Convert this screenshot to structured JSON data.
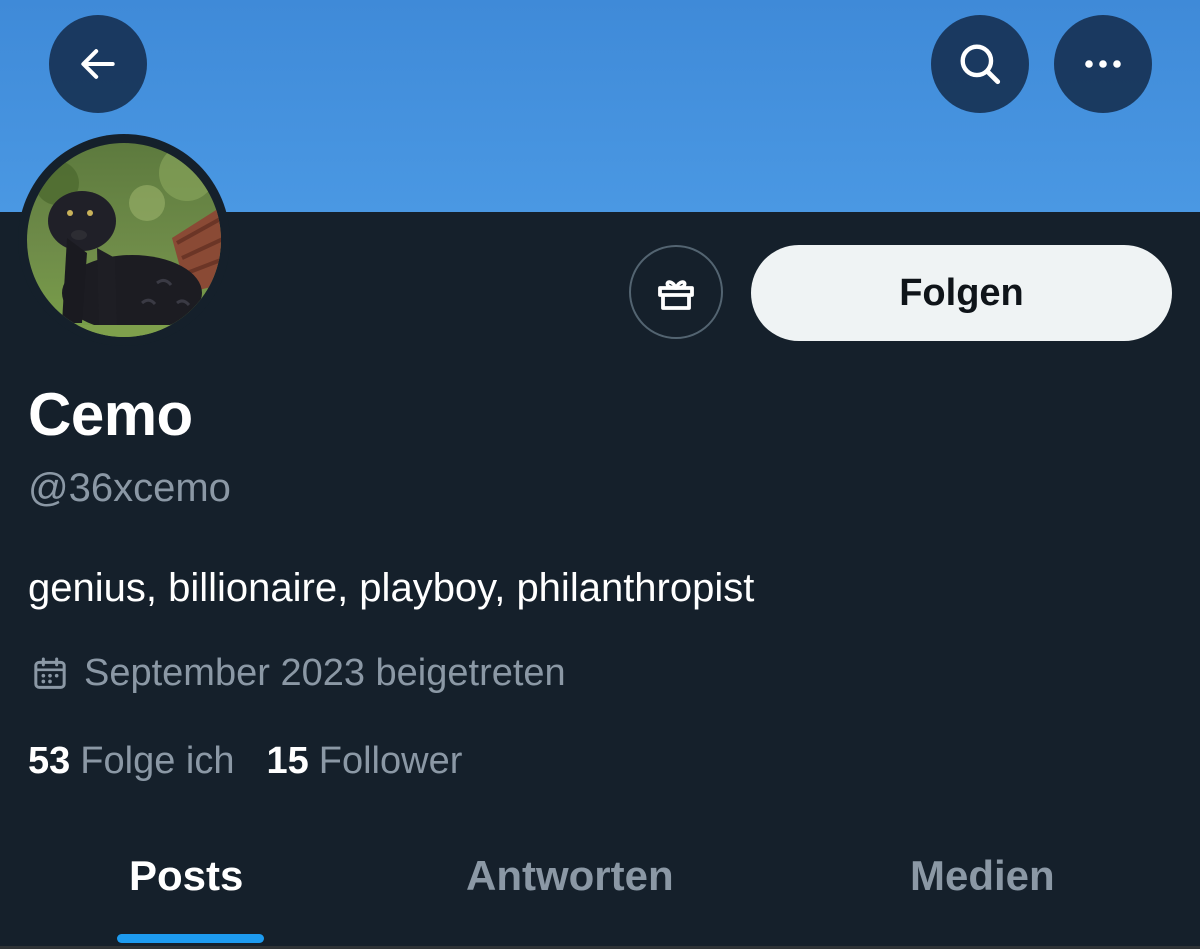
{
  "header": {
    "back_icon": "arrow-left-icon",
    "search_icon": "search-icon",
    "more_icon": "more-horizontal-icon",
    "banner_color": "#4a98e3"
  },
  "profile": {
    "display_name": "Cemo",
    "handle": "@36xcemo",
    "bio": "genius, billionaire, playboy, philanthropist",
    "joined": "September 2023 beigetreten",
    "following_count": "53",
    "following_label": "Folge ich",
    "followers_count": "15",
    "followers_label": "Follower"
  },
  "actions": {
    "gift_icon": "gift-icon",
    "follow_label": "Folgen"
  },
  "tabs": [
    {
      "label": "Posts",
      "active": true
    },
    {
      "label": "Antworten",
      "active": false
    },
    {
      "label": "Medien",
      "active": false
    }
  ],
  "colors": {
    "background": "#15202b",
    "accent": "#1d9bf0",
    "secondary_text": "#8b98a5"
  }
}
